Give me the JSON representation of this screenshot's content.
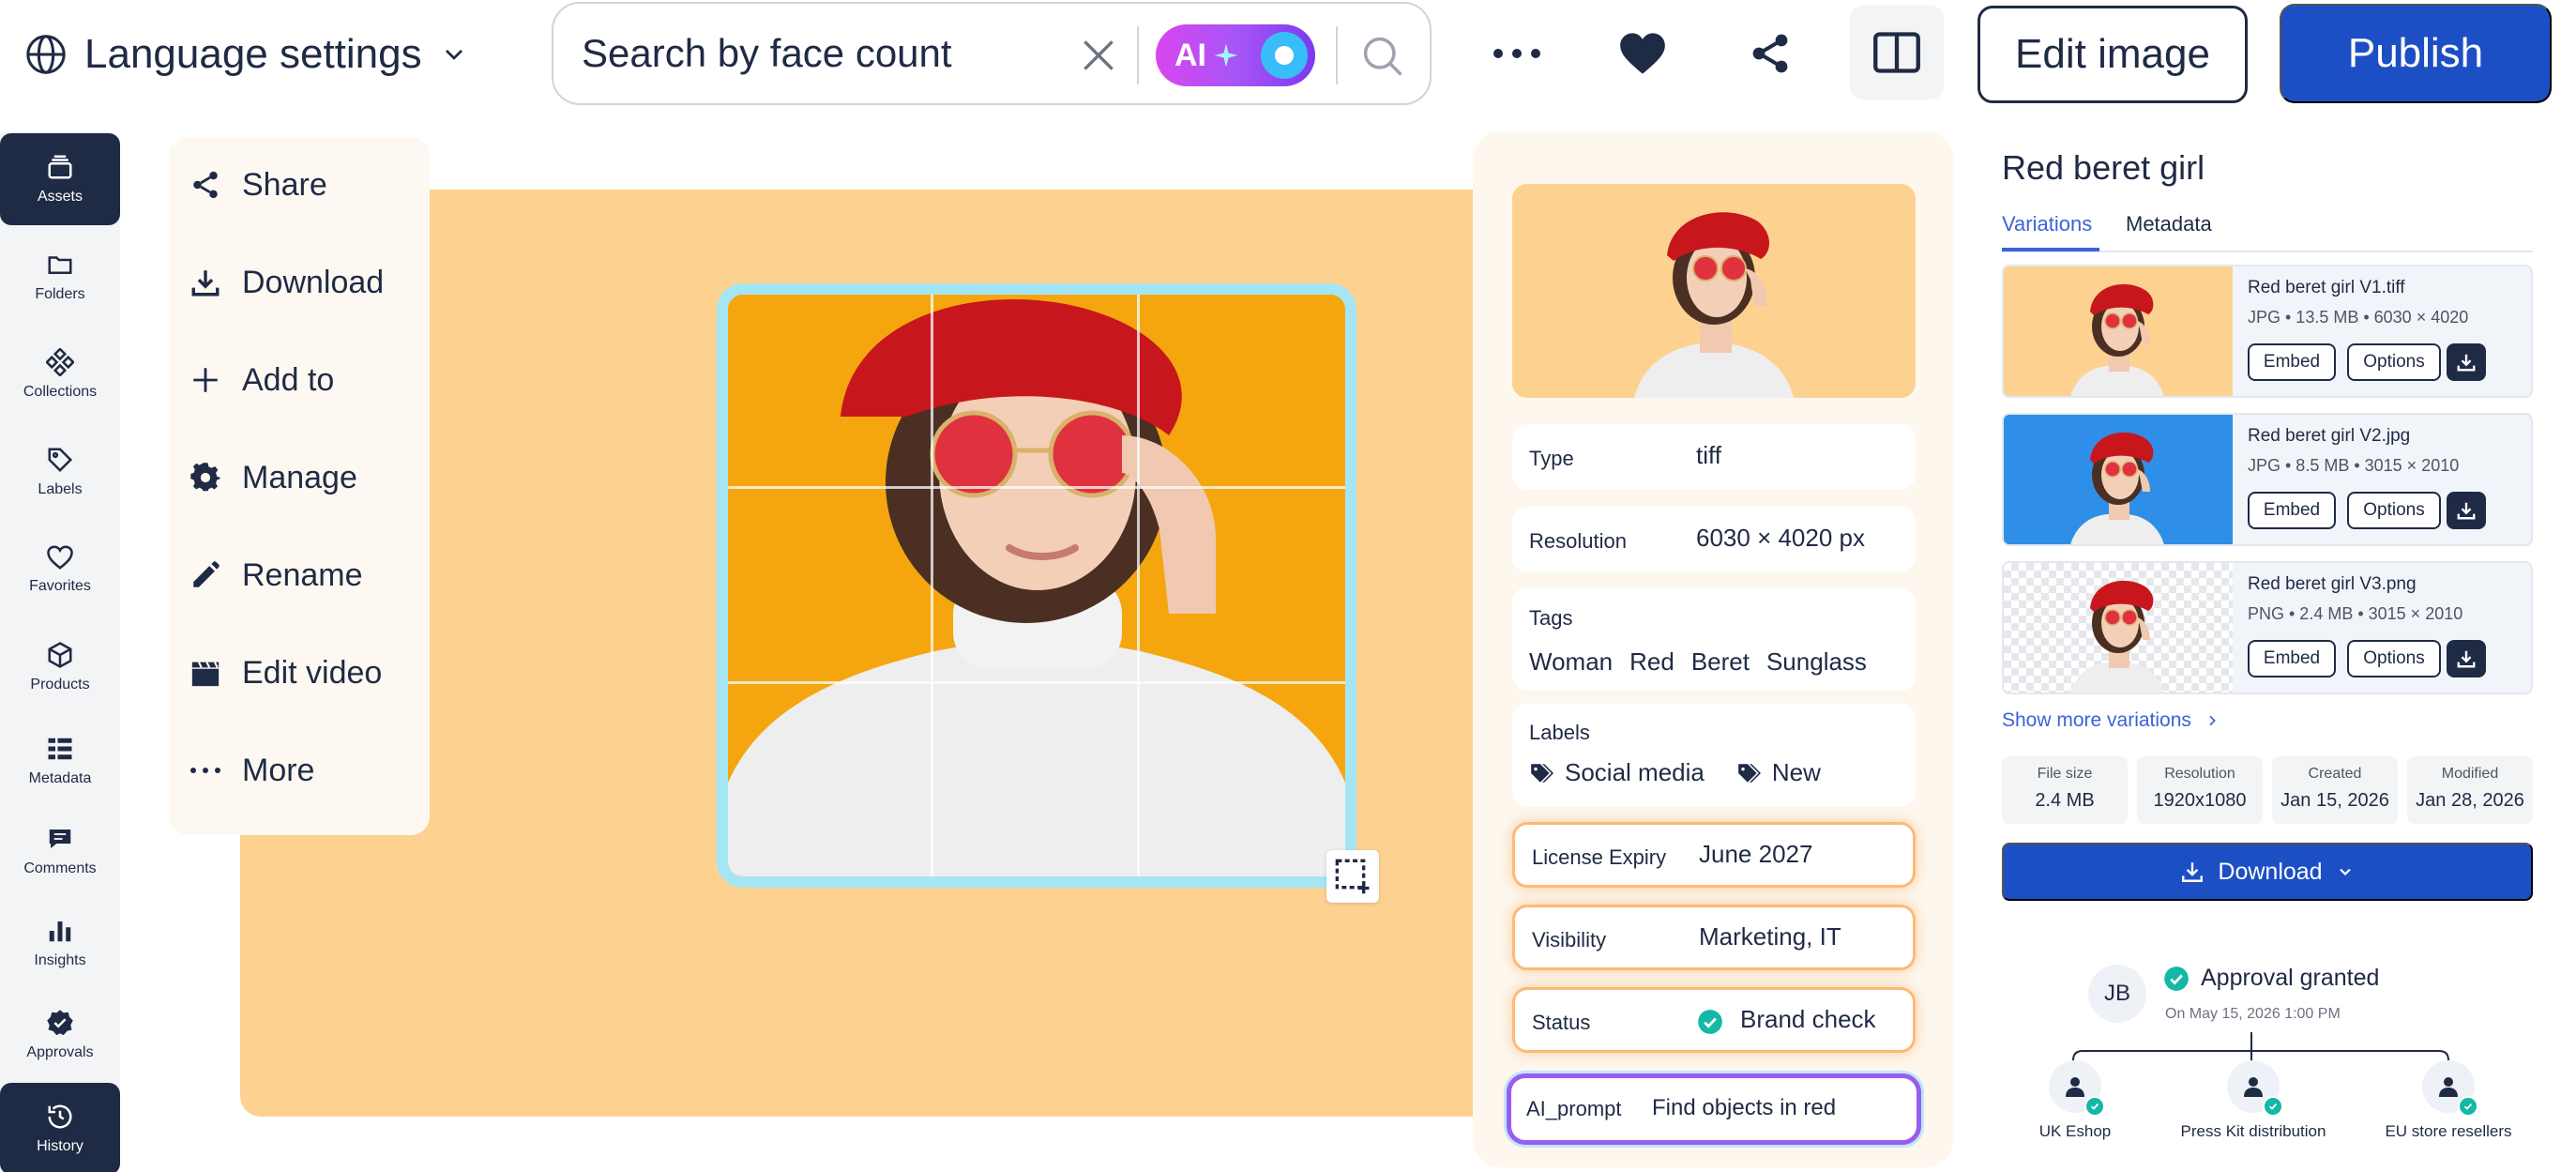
{
  "header": {
    "language_label": "Language settings",
    "search_placeholder": "Search by face count",
    "ai_label": "AI",
    "edit_label": "Edit image",
    "publish_label": "Publish"
  },
  "nav": {
    "items": [
      {
        "label": "Assets",
        "icon": "stack-icon",
        "active": true
      },
      {
        "label": "Folders",
        "icon": "folder-icon"
      },
      {
        "label": "Collections",
        "icon": "collections-icon"
      },
      {
        "label": "Labels",
        "icon": "tag-icon"
      },
      {
        "label": "Favorites",
        "icon": "heart-icon"
      },
      {
        "label": "Products",
        "icon": "cube-icon"
      },
      {
        "label": "Metadata",
        "icon": "metadata-icon"
      },
      {
        "label": "Comments",
        "icon": "comment-icon"
      },
      {
        "label": "Insights",
        "icon": "bar-chart-icon"
      },
      {
        "label": "Approvals",
        "icon": "badge-check-icon"
      },
      {
        "label": "History",
        "icon": "history-icon",
        "active": true
      }
    ]
  },
  "actions": {
    "items": [
      {
        "label": "Share",
        "icon": "share-icon"
      },
      {
        "label": "Download",
        "icon": "download-icon"
      },
      {
        "label": "Add to",
        "icon": "plus-icon"
      },
      {
        "label": "Manage",
        "icon": "gear-icon"
      },
      {
        "label": "Rename",
        "icon": "pencil-icon"
      },
      {
        "label": "Edit video",
        "icon": "clapper-icon"
      },
      {
        "label": "More",
        "icon": "ellipsis-icon"
      }
    ]
  },
  "details": {
    "type_label": "Type",
    "type_value": "tiff",
    "resolution_label": "Resolution",
    "resolution_value": "6030 × 4020 px",
    "tags_label": "Tags",
    "tags": [
      "Woman",
      "Red",
      "Beret",
      "Sunglass"
    ],
    "labels_label": "Labels",
    "labels": [
      "Social media",
      "New"
    ],
    "license_label": "License Expiry",
    "license_value": "June 2027",
    "visibility_label": "Visibility",
    "visibility_value": "Marketing, IT",
    "status_label": "Status",
    "status_value": "Brand check",
    "ai_prompt_label": "AI_prompt",
    "ai_prompt_value": "Find objects in red"
  },
  "asset": {
    "title": "Red beret girl",
    "tabs": [
      "Variations",
      "Metadata"
    ],
    "variations": [
      {
        "name": "Red beret girl V1.tiff",
        "meta": "JPG  •  13.5 MB  •  6030 × 4020",
        "bg": "#fdd291",
        "embed": "Embed",
        "options": "Options"
      },
      {
        "name": "Red beret girl V2.jpg",
        "meta": "JPG  •  8.5 MB  •  3015 × 2010",
        "bg": "#2f8fe8",
        "embed": "Embed",
        "options": "Options"
      },
      {
        "name": "Red beret girl V3.png",
        "meta": "PNG  •  2.4 MB  •  3015 × 2010",
        "bg": "checker",
        "embed": "Embed",
        "options": "Options"
      }
    ],
    "show_more": "Show more variations",
    "stats": [
      {
        "label": "File size",
        "value": "2.4 MB"
      },
      {
        "label": "Resolution",
        "value": "1920x1080"
      },
      {
        "label": "Created",
        "value": "Jan 15, 2026"
      },
      {
        "label": "Modified",
        "value": "Jan 28, 2026"
      }
    ],
    "download_label": "Download"
  },
  "approval": {
    "initials": "JB",
    "status": "Approval granted",
    "date": "On May 15, 2026 1:00 PM",
    "recipients": [
      "UK Eshop",
      "Press Kit distribution",
      "EU store resellers"
    ]
  },
  "colors": {
    "primary": "#1d4fc4",
    "canvas": "#fdd291",
    "crop_bg": "#f5a60f",
    "dark": "#1f2a44",
    "teal": "#14b8a6"
  }
}
